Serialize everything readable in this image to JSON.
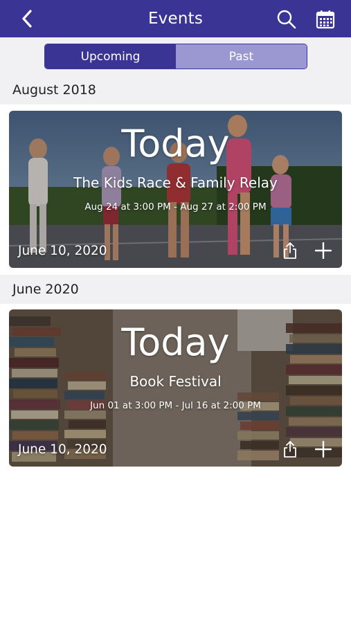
{
  "header": {
    "title": "Events",
    "back_icon": "chevron-left-icon",
    "search_icon": "search-icon",
    "calendar_icon": "calendar-icon",
    "background": "#3a3494"
  },
  "tabs": {
    "upcoming": "Upcoming",
    "past": "Past",
    "active": "upcoming"
  },
  "sections": [
    {
      "heading": "August 2018",
      "events": [
        {
          "badge": "Today",
          "name": "The Kids Race & Family Relay",
          "range": "Aug 24 at 3:00 PM - Aug 27 at 2:00 PM",
          "date": "June 10, 2020",
          "image": "children-running-photo"
        }
      ]
    },
    {
      "heading": "June 2020",
      "events": [
        {
          "badge": "Today",
          "name": "Book Festival",
          "range": "Jun 01 at 3:00 PM - Jul 16 at 2:00 PM",
          "date": "June 10, 2020",
          "image": "book-stacks-photo"
        }
      ]
    }
  ]
}
